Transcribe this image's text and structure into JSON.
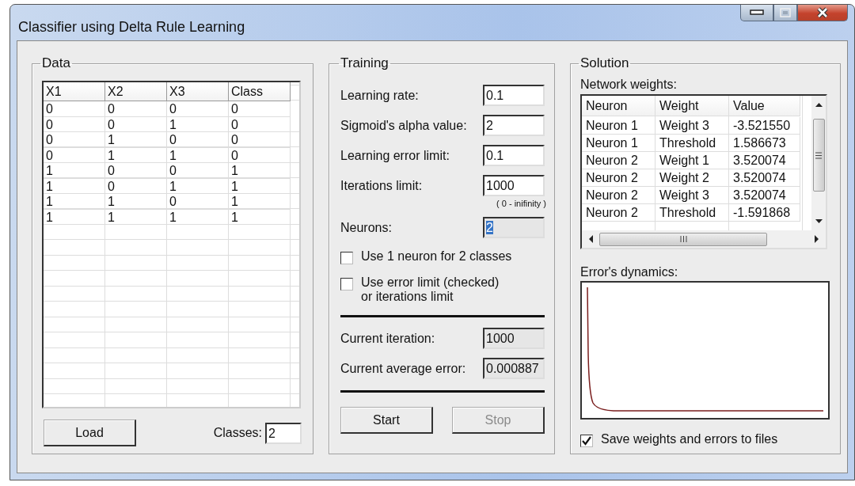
{
  "window": {
    "title": "Classifier using Delta Rule Learning"
  },
  "data": {
    "title": "Data",
    "columns": [
      "X1",
      "X2",
      "X3",
      "Class"
    ],
    "rows": [
      [
        "0",
        "0",
        "0",
        "0"
      ],
      [
        "0",
        "0",
        "1",
        "0"
      ],
      [
        "0",
        "1",
        "0",
        "0"
      ],
      [
        "0",
        "1",
        "1",
        "0"
      ],
      [
        "1",
        "0",
        "0",
        "1"
      ],
      [
        "1",
        "0",
        "1",
        "1"
      ],
      [
        "1",
        "1",
        "0",
        "1"
      ],
      [
        "1",
        "1",
        "1",
        "1"
      ]
    ],
    "load_button": "Load",
    "classes_label": "Classes:",
    "classes_value": "2"
  },
  "training": {
    "title": "Training",
    "fields": [
      {
        "label": "Learning rate:",
        "value": "0.1",
        "disabled": false,
        "text_selected": false
      },
      {
        "label": "Sigmoid's alpha value:",
        "value": "2",
        "disabled": false,
        "text_selected": false
      },
      {
        "label": "Learning error limit:",
        "value": "0.1",
        "disabled": false,
        "text_selected": false
      },
      {
        "label": "Iterations limit:",
        "value": "1000",
        "disabled": false,
        "text_selected": false,
        "hint": "( 0 - inifinity )"
      },
      {
        "label": "Neurons:",
        "value": "2",
        "disabled": true,
        "text_selected": true
      }
    ],
    "checkboxes": [
      {
        "label": "Use 1 neuron for 2 classes",
        "checked": false
      },
      {
        "label": "Use error limit (checked)\nor iterations limit",
        "checked": false
      }
    ],
    "status": [
      {
        "label": "Current iteration:",
        "value": "1000"
      },
      {
        "label": "Current average error:",
        "value": "0.000887"
      }
    ],
    "buttons": [
      {
        "label": "Start",
        "disabled": false
      },
      {
        "label": "Stop",
        "disabled": true
      }
    ]
  },
  "solution": {
    "title": "Solution",
    "weights_label": "Network weights:",
    "columns": [
      "Neuron",
      "Weight",
      "Value"
    ],
    "rows": [
      [
        "Neuron 1",
        "Weight 3",
        "-3.521550"
      ],
      [
        "Neuron 1",
        "Threshold",
        "1.586673"
      ],
      [
        "Neuron 2",
        "Weight 1",
        "3.520074"
      ],
      [
        "Neuron 2",
        "Weight 2",
        "3.520074"
      ],
      [
        "Neuron 2",
        "Weight 3",
        "3.520074"
      ],
      [
        "Neuron 2",
        "Threshold",
        "-1.591868"
      ]
    ],
    "chart_label": "Error's dynamics:",
    "save_checkbox": {
      "label": "Save weights and errors to files",
      "checked": true
    }
  }
}
